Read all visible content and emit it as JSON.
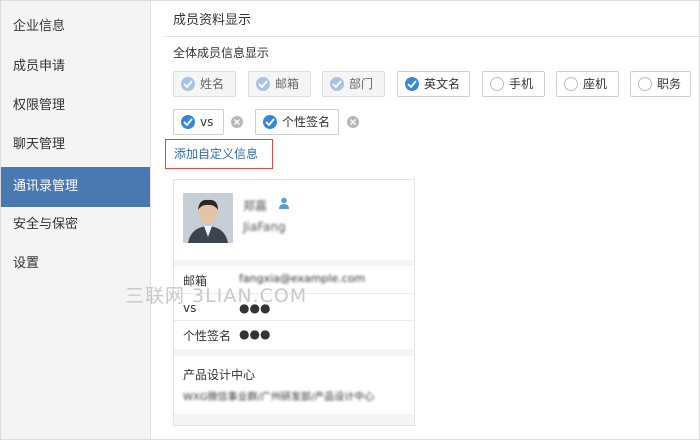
{
  "sidebar": {
    "items": [
      {
        "label": "企业信息"
      },
      {
        "label": "成员申请"
      },
      {
        "label": "权限管理"
      },
      {
        "label": "聊天管理"
      },
      {
        "label": "通讯录管理",
        "active": true
      },
      {
        "label": "安全与保密"
      },
      {
        "label": "设置"
      }
    ]
  },
  "main": {
    "section_title": "成员资料显示",
    "sub_title": "全体成员信息显示",
    "fields": [
      {
        "label": "姓名",
        "checked": true,
        "locked": true
      },
      {
        "label": "邮箱",
        "checked": true,
        "locked": true
      },
      {
        "label": "部门",
        "checked": true,
        "locked": true
      },
      {
        "label": "英文名",
        "checked": true
      },
      {
        "label": "手机",
        "checked": false
      },
      {
        "label": "座机",
        "checked": false
      },
      {
        "label": "职务",
        "checked": false
      }
    ],
    "custom_fields": [
      {
        "label": "vs",
        "checked": true
      },
      {
        "label": "个性签名",
        "checked": true
      }
    ],
    "add_custom_label": "添加自定义信息"
  },
  "preview": {
    "name": "郑嘉",
    "english_name": "JiaFang",
    "email_label": "邮箱",
    "email_value": "fangxia@example.com",
    "rows": [
      {
        "label": "vs",
        "value": "●●●"
      },
      {
        "label": "个性签名",
        "value": "●●●"
      }
    ],
    "department": "产品设计中心",
    "department_path": "WXG微信事业群/广州研发部/产品设计中心"
  },
  "watermark": "三联网 3LIAN.COM",
  "colors": {
    "accent": "#3a86d6",
    "sidebar_active": "#4a78b0",
    "link": "#2f6db5",
    "highlight_border": "#e04a4a"
  }
}
